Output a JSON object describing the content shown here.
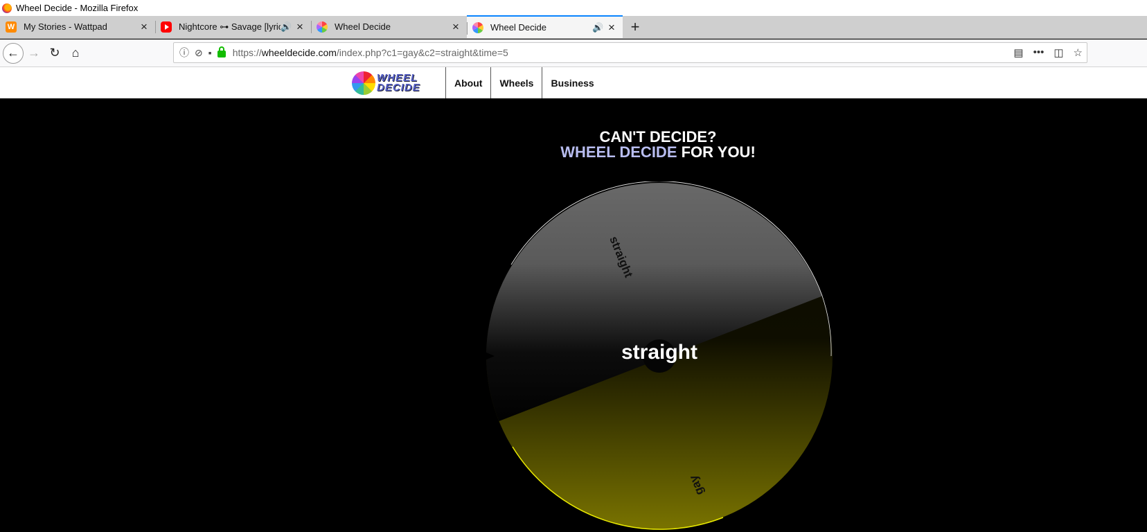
{
  "window": {
    "title": "Wheel Decide - Mozilla Firefox"
  },
  "tabs": [
    {
      "label": "My Stories - Wattpad",
      "icon": "wattpad-icon",
      "audio": false,
      "active": false
    },
    {
      "label": "Nightcore ⊶ Savage [lyrics]",
      "icon": "youtube-icon",
      "audio": true,
      "active": false
    },
    {
      "label": "Wheel Decide",
      "icon": "wheeldecide-icon",
      "audio": false,
      "active": false
    },
    {
      "label": "Wheel Decide",
      "icon": "wheeldecide-icon",
      "audio": true,
      "active": true
    }
  ],
  "url": {
    "prefix": "https://",
    "host": "wheeldecide.com",
    "rest": "/index.php?c1=gay&c2=straight&time=5"
  },
  "site": {
    "nav": [
      "About",
      "Wheels",
      "Business"
    ],
    "logo_alt": "WHEEL DECIDE"
  },
  "headline": {
    "line1": "CAN'T DECIDE?",
    "accent": "WHEEL DECIDE",
    "rest": " FOR YOU!"
  },
  "wheel": {
    "choices": [
      {
        "label": "straight",
        "color": "#666666"
      },
      {
        "label": "gay",
        "color": "#666600"
      }
    ],
    "result": "straight"
  },
  "colors": {
    "accent": "#b8bdf0",
    "active_tab": "#0a84ff"
  }
}
